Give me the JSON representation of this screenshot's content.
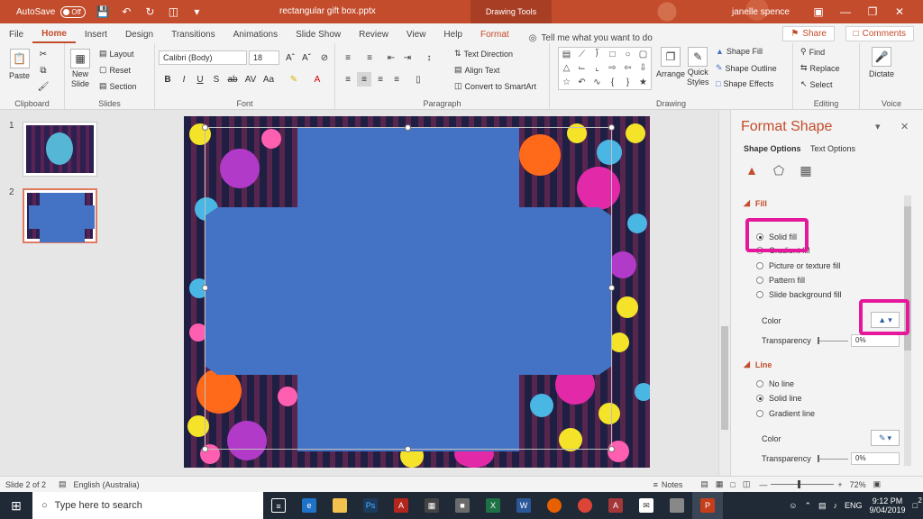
{
  "titlebar": {
    "autosave_label": "AutoSave",
    "autosave_state": "Off",
    "file_name": "rectangular gift box.pptx",
    "context_tab": "Drawing Tools",
    "user_name": "janelle spence"
  },
  "tabs": [
    "File",
    "Home",
    "Insert",
    "Design",
    "Transitions",
    "Animations",
    "Slide Show",
    "Review",
    "View",
    "Help",
    "Format"
  ],
  "tell_me": "Tell me what you want to do",
  "share_label": "Share",
  "comments_label": "Comments",
  "ribbon": {
    "clipboard": {
      "paste": "Paste",
      "label": "Clipboard"
    },
    "slides": {
      "new_slide": "New",
      "new_slide_2": "Slide",
      "layout": "Layout",
      "reset": "Reset",
      "section": "Section",
      "label": "Slides"
    },
    "font": {
      "font_name": "Calibri (Body)",
      "font_size": "18",
      "label": "Font"
    },
    "paragraph": {
      "text_direction": "Text Direction",
      "align_text": "Align Text",
      "convert_smartart": "Convert to SmartArt",
      "label": "Paragraph"
    },
    "drawing": {
      "arrange": "Arrange",
      "quick_styles": "Quick",
      "quick_styles_2": "Styles",
      "shape_fill": "Shape Fill",
      "shape_outline": "Shape Outline",
      "shape_effects": "Shape Effects",
      "label": "Drawing"
    },
    "editing": {
      "find": "Find",
      "replace": "Replace",
      "select": "Select",
      "label": "Editing"
    },
    "voice": {
      "dictate": "Dictate",
      "label": "Voice"
    }
  },
  "slides_panel": {
    "thumbs": [
      {
        "num": "1"
      },
      {
        "num": "2"
      }
    ]
  },
  "format_pane": {
    "title": "Format Shape",
    "tab_shape": "Shape Options",
    "tab_text": "Text Options",
    "fill_header": "Fill",
    "fill_options": [
      "Solid fill",
      "Gradient fill",
      "Picture or texture fill",
      "Pattern fill",
      "Slide background fill"
    ],
    "fill_selected": "Solid fill",
    "color_label": "Color",
    "transparency_label": "Transparency",
    "transparency_value": "0%",
    "line_header": "Line",
    "line_options": [
      "No line",
      "Solid line",
      "Gradient line"
    ],
    "line_selected": "Solid line",
    "line_color_label": "Color",
    "line_transparency_label": "Transparency",
    "line_transparency_value": "0%"
  },
  "statusbar": {
    "slide_info": "Slide 2 of 2",
    "language": "English (Australia)",
    "notes": "Notes",
    "zoom": "72%"
  },
  "taskbar": {
    "search_placeholder": "Type here to search",
    "lang": "ENG",
    "time": "9:12 PM",
    "date": "9/04/2019",
    "notification_count": "2"
  },
  "colors": {
    "accent": "#c34c2c",
    "shape_fill": "#4472c4",
    "highlight": "#e5179a"
  }
}
